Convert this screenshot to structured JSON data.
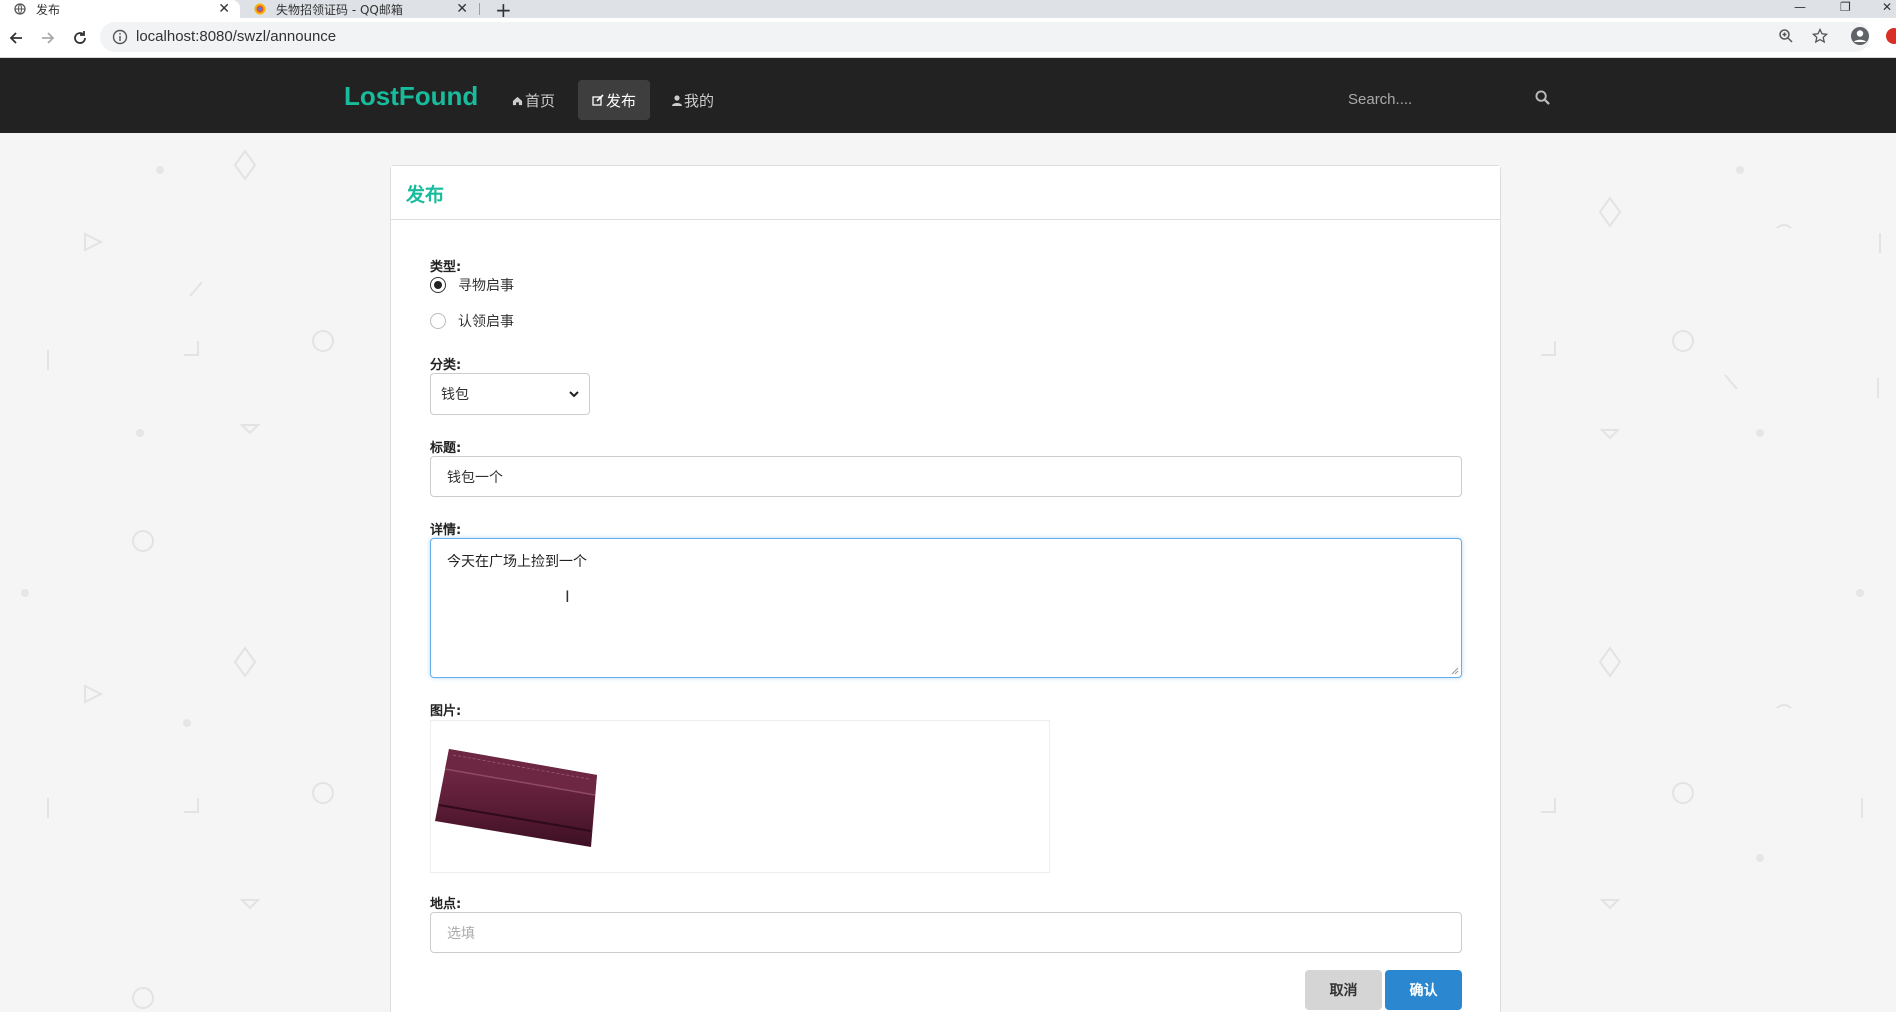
{
  "browser": {
    "tabs": [
      {
        "title": "发布",
        "active": true
      },
      {
        "title": "失物招领证码 - QQ邮箱",
        "active": false
      }
    ],
    "url": "localhost:8080/swzl/announce"
  },
  "navbar": {
    "brand": "LostFound",
    "links": [
      {
        "label": "首页",
        "icon": "home-icon"
      },
      {
        "label": "发布",
        "icon": "edit-icon",
        "active": true
      },
      {
        "label": "我的",
        "icon": "user-icon"
      }
    ],
    "search_placeholder": "Search...."
  },
  "panel": {
    "title": "发布"
  },
  "form": {
    "type_label": "类型:",
    "type_options": [
      "寻物启事",
      "认领启事"
    ],
    "type_selected": "寻物启事",
    "category_label": "分类:",
    "category_value": "钱包",
    "title_label": "标题:",
    "title_value": "钱包一个",
    "detail_label": "详情:",
    "detail_value": "今天在广场上捡到一个",
    "image_label": "图片:",
    "image_subject": "wallet",
    "location_label": "地点:",
    "location_placeholder": "选填",
    "cancel_label": "取消",
    "confirm_label": "确认"
  },
  "colors": {
    "brand": "#18bc9c",
    "navbar_bg": "#222222",
    "confirm_button": "#2a87d0",
    "cancel_button": "#d5d5d5"
  }
}
